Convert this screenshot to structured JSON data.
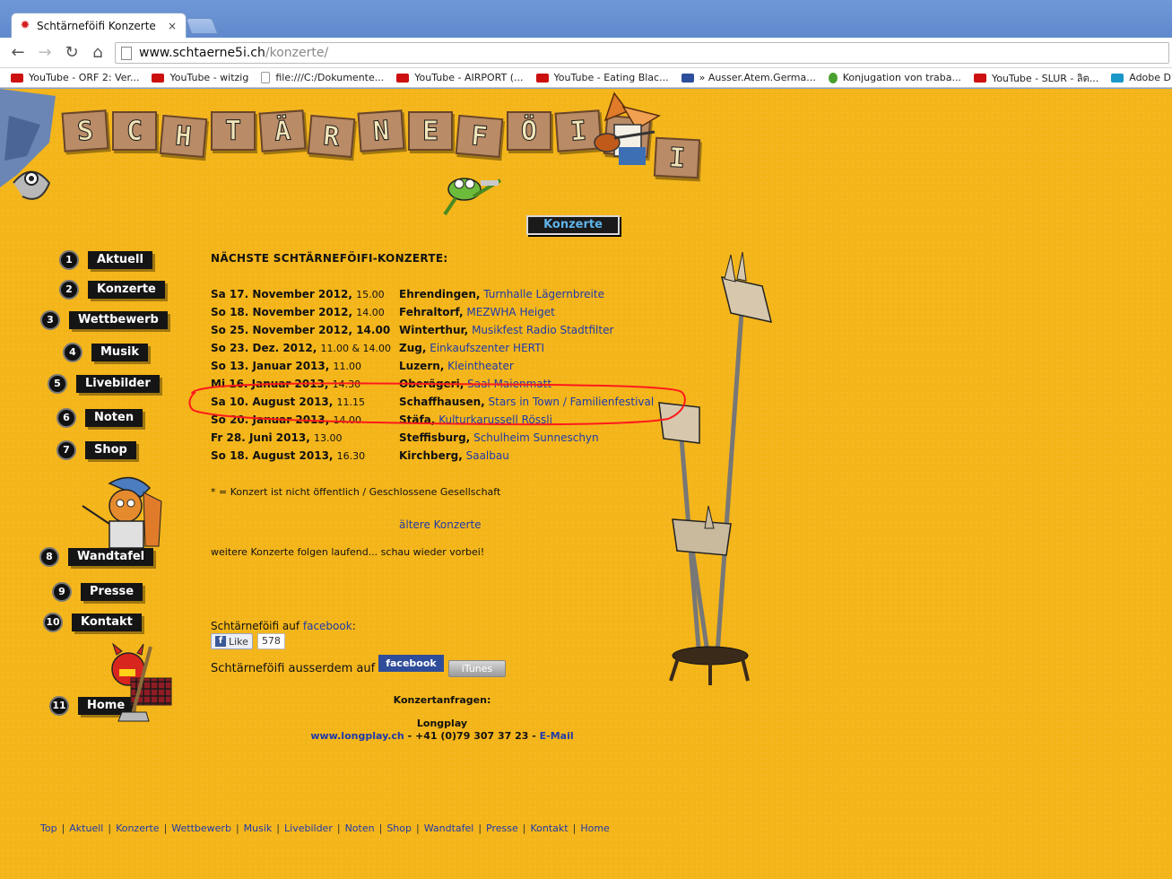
{
  "browser": {
    "tab_title": "Schtärneföifi Konzerte",
    "tab_close": "×",
    "url_host": "www.schtaerne5i.ch",
    "url_path": "/konzerte/",
    "back_glyph": "←",
    "forward_glyph": "→",
    "reload_glyph": "↻",
    "home_glyph": "⌂",
    "bookmarks": [
      {
        "label": "YouTube - ORF 2: Ver...",
        "icon": "youtube-icon"
      },
      {
        "label": "YouTube - witzig",
        "icon": "youtube-icon"
      },
      {
        "label": "file:///C:/Dokumente...",
        "icon": "file-icon"
      },
      {
        "label": "YouTube - AIRPORT (...",
        "icon": "youtube-icon"
      },
      {
        "label": "YouTube - Eating Blac...",
        "icon": "youtube-icon"
      },
      {
        "label": "» Ausser.Atem.Germa...",
        "icon": "blog-icon"
      },
      {
        "label": "Konjugation von traba...",
        "icon": "person-icon"
      },
      {
        "label": "YouTube - SLUR - ลิต...",
        "icon": "youtube-icon"
      },
      {
        "label": "Adobe Dreamweaver ...",
        "icon": "k-icon"
      }
    ]
  },
  "logo": {
    "letters": [
      "S",
      "C",
      "H",
      "T",
      "Ä",
      "R",
      "N",
      "E",
      "F",
      "Ö",
      "I",
      "F",
      "I"
    ]
  },
  "section_label": "Konzerte",
  "nav": [
    {
      "num": "1",
      "label": "Aktuell"
    },
    {
      "num": "2",
      "label": "Konzerte"
    },
    {
      "num": "3",
      "label": "Wettbewerb"
    },
    {
      "num": "4",
      "label": "Musik"
    },
    {
      "num": "5",
      "label": "Livebilder"
    },
    {
      "num": "6",
      "label": "Noten"
    },
    {
      "num": "7",
      "label": "Shop"
    },
    {
      "num": "8",
      "label": "Wandtafel"
    },
    {
      "num": "9",
      "label": "Presse"
    },
    {
      "num": "10",
      "label": "Kontakt"
    },
    {
      "num": "11",
      "label": "Home"
    }
  ],
  "main": {
    "heading": "NÄCHSTE SCHTÄRNEFÖIFI-KONZERTE:",
    "concerts": [
      {
        "date": "Sa 17. November 2012,",
        "time": "15.00",
        "city": "Ehrendingen,",
        "venue": "Turnhalle Lägernbreite"
      },
      {
        "date": "So 18. November 2012,",
        "time": "14.00",
        "city": "Fehraltorf,",
        "venue": "MEZWHA Heiget"
      },
      {
        "date": "So 25. November 2012, 14.00",
        "time": "",
        "city": "Winterthur,",
        "venue": "Musikfest Radio Stadtfilter"
      },
      {
        "date": "So 23. Dez. 2012,",
        "time": "11.00 & 14.00",
        "city": "Zug,",
        "venue": "Einkaufszenter HERTI"
      },
      {
        "date": "So 13. Januar 2013,",
        "time": "11.00",
        "city": "Luzern,",
        "venue": "Kleintheater"
      },
      {
        "date": "Mi 16. Januar 2013,",
        "time": "14.30",
        "city": "Oberägeri,",
        "venue": "Saal Maienmatt"
      },
      {
        "date": "Sa 10. August 2013,",
        "time": "11.15",
        "city": "Schaffhausen,",
        "venue": "Stars in Town / Familienfestival"
      },
      {
        "date": "So 20. Januar 2013,",
        "time": "14.00",
        "city": "Stäfa,",
        "venue": "Kulturkarussell Rössli"
      },
      {
        "date": "Fr 28. Juni 2013,",
        "time": "13.00",
        "city": "Steffisburg,",
        "venue": "Schulheim Sunneschyn"
      },
      {
        "date": "So 18. August 2013,",
        "time": "16.30",
        "city": "Kirchberg,",
        "venue": "Saalbau"
      }
    ],
    "note": "* = Konzert ist nicht öffentlich / Geschlossene Gesellschaft",
    "older_link": "ältere Konzerte",
    "more_text": "weitere Konzerte folgen laufend... schau wieder vorbei!",
    "fb_prefix": "Schtärneföifi auf ",
    "fb_link": "facebook",
    "fb_suffix": ":",
    "like_label": "Like",
    "like_count": "578",
    "also_text": "Schtärneföifi ausserdem auf",
    "facebook_badge": "facebook",
    "itunes_badge": "iTunes",
    "inquiry_heading": "Konzertanfragen:",
    "agency": "Longplay",
    "agency_link": "www.longplay.ch",
    "phone": " - +41 (0)79 307 37 23 - ",
    "email_link": "E-Mail"
  },
  "footer": [
    "Top",
    "Aktuell",
    "Konzerte",
    "Wettbewerb",
    "Musik",
    "Livebilder",
    "Noten",
    "Shop",
    "Wandtafel",
    "Presse",
    "Kontakt",
    "Home"
  ],
  "colors": {
    "page_bg": "#f4b51a",
    "link": "#1f3aa8",
    "annotation": "#ff1a1a"
  }
}
